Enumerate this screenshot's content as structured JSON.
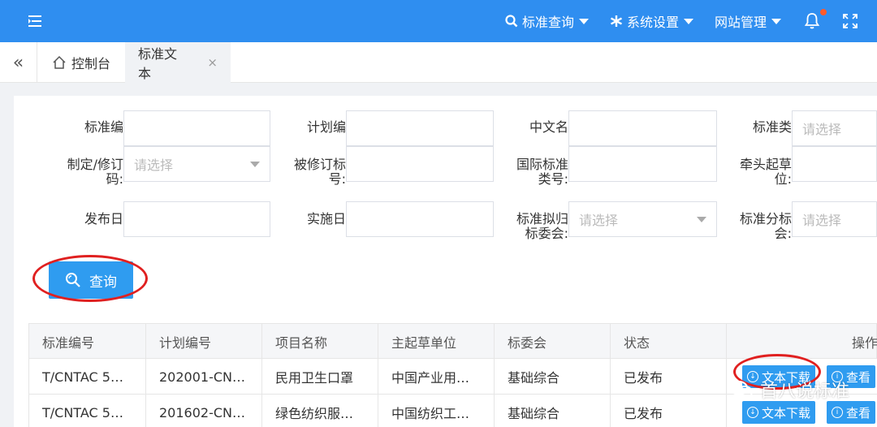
{
  "topbar": {
    "nav": [
      {
        "label": "标准查询",
        "icon": "search-icon"
      },
      {
        "label": "系统设置",
        "icon": "gear-icon"
      },
      {
        "label": "网站管理",
        "icon": ""
      }
    ],
    "colors": {
      "bar": "#2f8ef0",
      "notification_dot": "#ff5a2a"
    }
  },
  "tabs": {
    "home": "控制台",
    "active": "标准文本",
    "close": "×"
  },
  "form": {
    "rows": [
      [
        {
          "label": "标准编",
          "value": "",
          "placeholder": ""
        },
        {
          "label": "计划编",
          "value": "",
          "placeholder": ""
        },
        {
          "label": "中文名",
          "value": "",
          "placeholder": ""
        },
        {
          "label": "标准类",
          "value": "",
          "placeholder": "请选择"
        }
      ],
      [
        {
          "label": "制定/修订",
          "label2": "码:",
          "placeholder": "请选择",
          "select": true
        },
        {
          "label": "被修订标",
          "label2": "号:",
          "placeholder": ""
        },
        {
          "label": "国际标准",
          "label2": "类号:",
          "placeholder": ""
        },
        {
          "label": "牵头起草",
          "label2": "位:",
          "placeholder": ""
        }
      ],
      [
        {
          "label": "发布日",
          "placeholder": ""
        },
        {
          "label": "实施日",
          "placeholder": ""
        },
        {
          "label": "标准拟归",
          "label2": "标委会:",
          "placeholder": "请选择",
          "select": true
        },
        {
          "label": "标准分标",
          "label2": "会:",
          "placeholder": "请选择"
        }
      ]
    ],
    "search_label": "查询"
  },
  "table": {
    "headers": [
      "标准编号",
      "计划编号",
      "项目名称",
      "主起草单位",
      "标委会",
      "状态",
      "操作"
    ],
    "rows": [
      [
        "T/CNTAC 5…",
        "202001-CN…",
        "民用卫生口罩",
        "中国产业用…",
        "基础综合",
        "已发布"
      ],
      [
        "T/CNTAC 5…",
        "201602-CN…",
        "绿色纺织服…",
        "中国纺织工…",
        "基础综合",
        "已发布"
      ]
    ],
    "download_label": "文本下载",
    "view_label": "查看"
  },
  "watermark": "首八说标准"
}
